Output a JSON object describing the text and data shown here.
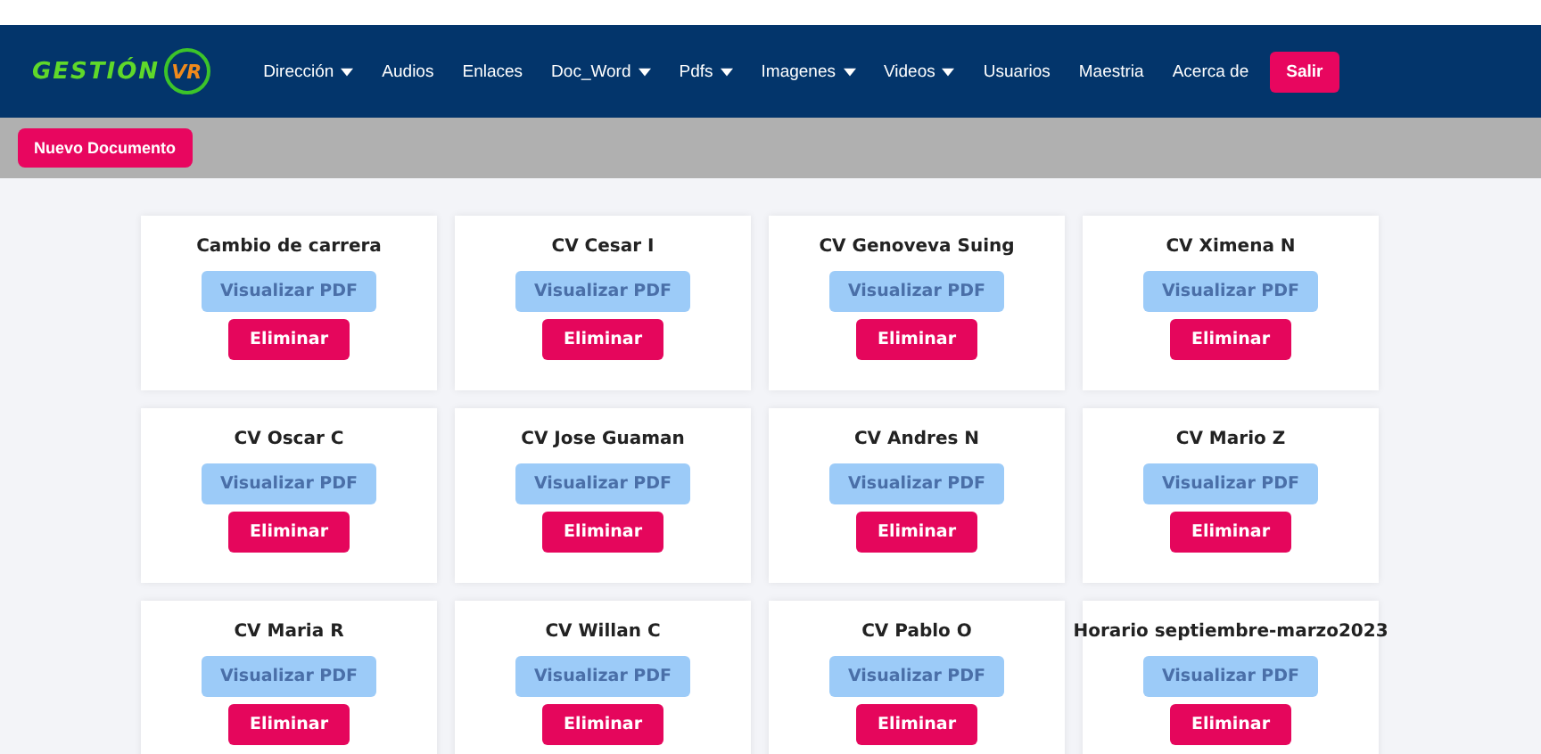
{
  "logo": {
    "text": "GESTIÓN",
    "badge": "VR"
  },
  "nav": [
    {
      "label": "Dirección",
      "dropdown": true
    },
    {
      "label": "Audios",
      "dropdown": false
    },
    {
      "label": "Enlaces",
      "dropdown": false
    },
    {
      "label": "Doc_Word",
      "dropdown": true
    },
    {
      "label": "Pdfs",
      "dropdown": true
    },
    {
      "label": "Imagenes",
      "dropdown": true
    },
    {
      "label": "Videos",
      "dropdown": true
    },
    {
      "label": "Usuarios",
      "dropdown": false
    },
    {
      "label": "Maestria",
      "dropdown": false
    },
    {
      "label": "Acerca de",
      "dropdown": false
    }
  ],
  "logout_button": "Salir",
  "new_button": "Nuevo Documento",
  "documents": [
    {
      "title": "Cambio de carrera",
      "view": "Visualizar PDF",
      "delete": "Eliminar"
    },
    {
      "title": "CV Cesar I",
      "view": "Visualizar PDF",
      "delete": "Eliminar"
    },
    {
      "title": "CV Genoveva Suing",
      "view": "Visualizar PDF",
      "delete": "Eliminar"
    },
    {
      "title": "CV Ximena N",
      "view": "Visualizar PDF",
      "delete": "Eliminar"
    },
    {
      "title": "CV Oscar C",
      "view": "Visualizar PDF",
      "delete": "Eliminar"
    },
    {
      "title": "CV Jose Guaman",
      "view": "Visualizar PDF",
      "delete": "Eliminar"
    },
    {
      "title": "CV Andres N",
      "view": "Visualizar PDF",
      "delete": "Eliminar"
    },
    {
      "title": "CV Mario Z",
      "view": "Visualizar PDF",
      "delete": "Eliminar"
    },
    {
      "title": "CV Maria R",
      "view": "Visualizar PDF",
      "delete": "Eliminar"
    },
    {
      "title": "CV Willan C",
      "view": "Visualizar PDF",
      "delete": "Eliminar"
    },
    {
      "title": "CV Pablo O",
      "view": "Visualizar PDF",
      "delete": "Eliminar"
    },
    {
      "title": "Horario septiembre-marzo2023",
      "view": "Visualizar PDF",
      "delete": "Eliminar"
    }
  ]
}
